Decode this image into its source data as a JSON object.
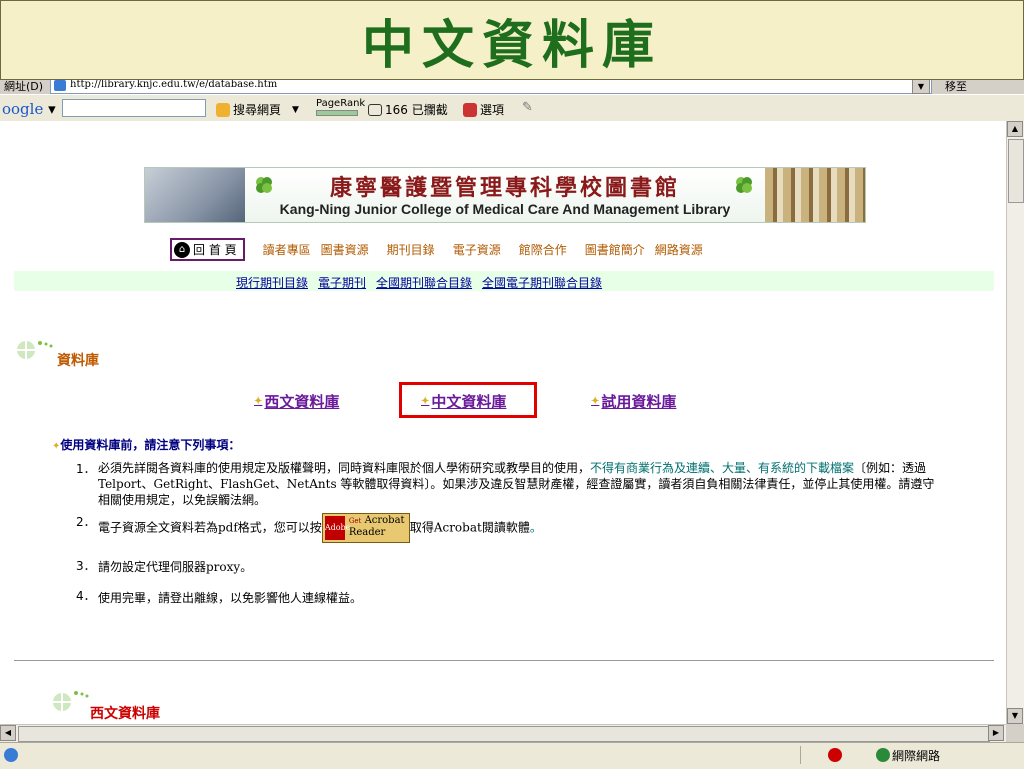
{
  "slide": {
    "title": "中文資料庫"
  },
  "browser": {
    "address_label": "網址(D)",
    "url": "http://library.knjc.edu.tw/e/database.htm",
    "go_label": "移至",
    "google": {
      "logo": "oogle",
      "search_label": "搜尋網頁",
      "pagerank_label": "PageRank",
      "blocked_label": "166 已攔截",
      "options_label": "選項"
    },
    "status_zone": "網際網路"
  },
  "page": {
    "banner": {
      "title_cn": "康寧醫護暨管理專科學校圖書館",
      "title_en": "Kang-Ning Junior College of Medical Care And Management Library"
    },
    "home_label": "回 首 頁",
    "nav": [
      "讀者專區",
      "圖書資源",
      "期刊目錄",
      "電子資源",
      "館際合作",
      "圖書館簡介",
      "網路資源"
    ],
    "subnav": [
      "現行期刊目錄",
      "電子期刊",
      "全國期刊聯合目錄",
      "全國電子期刊聯合目錄"
    ],
    "section_title": "資料庫",
    "db_links": {
      "western": "西文資料庫",
      "chinese": "中文資料庫",
      "trial": "試用資料庫"
    },
    "notice_head": "使用資料庫前，請注意下列事項：",
    "notices": {
      "n1_num": "1．",
      "n1_a": "必須先詳閱各資料庫的使用規定及版權聲明，同時資料庫限於個人學術研究或教學目的使用，",
      "n1_b": "不得有商業行為及連續、大量、有系統的下載檔案",
      "n1_c": "〔例如：透過 Telport、GetRight、FlashGet、NetAnts 等軟體取得資料〕。如果涉及違反智慧財產權，經查證屬實，讀者須自負相關法律責任，並停止其使用權。請遵守相關使用規定，以免誤觸法網。",
      "n2_num": "2．",
      "n2_a": "電子資源全文資料若為pdf格式，您可以按",
      "n2_b": "取得Acrobat閱讀軟體",
      "n2_c": "。",
      "acrobat_brand": "Adobe",
      "acrobat_get": "Get",
      "acrobat_name": "Acrobat Reader",
      "n3_num": "3．",
      "n3": "請勿設定代理伺服器proxy。",
      "n4_num": "4．",
      "n4": "使用完畢，請登出離線，以免影響他人連線權益。"
    },
    "section2_title": "西文資料庫"
  }
}
